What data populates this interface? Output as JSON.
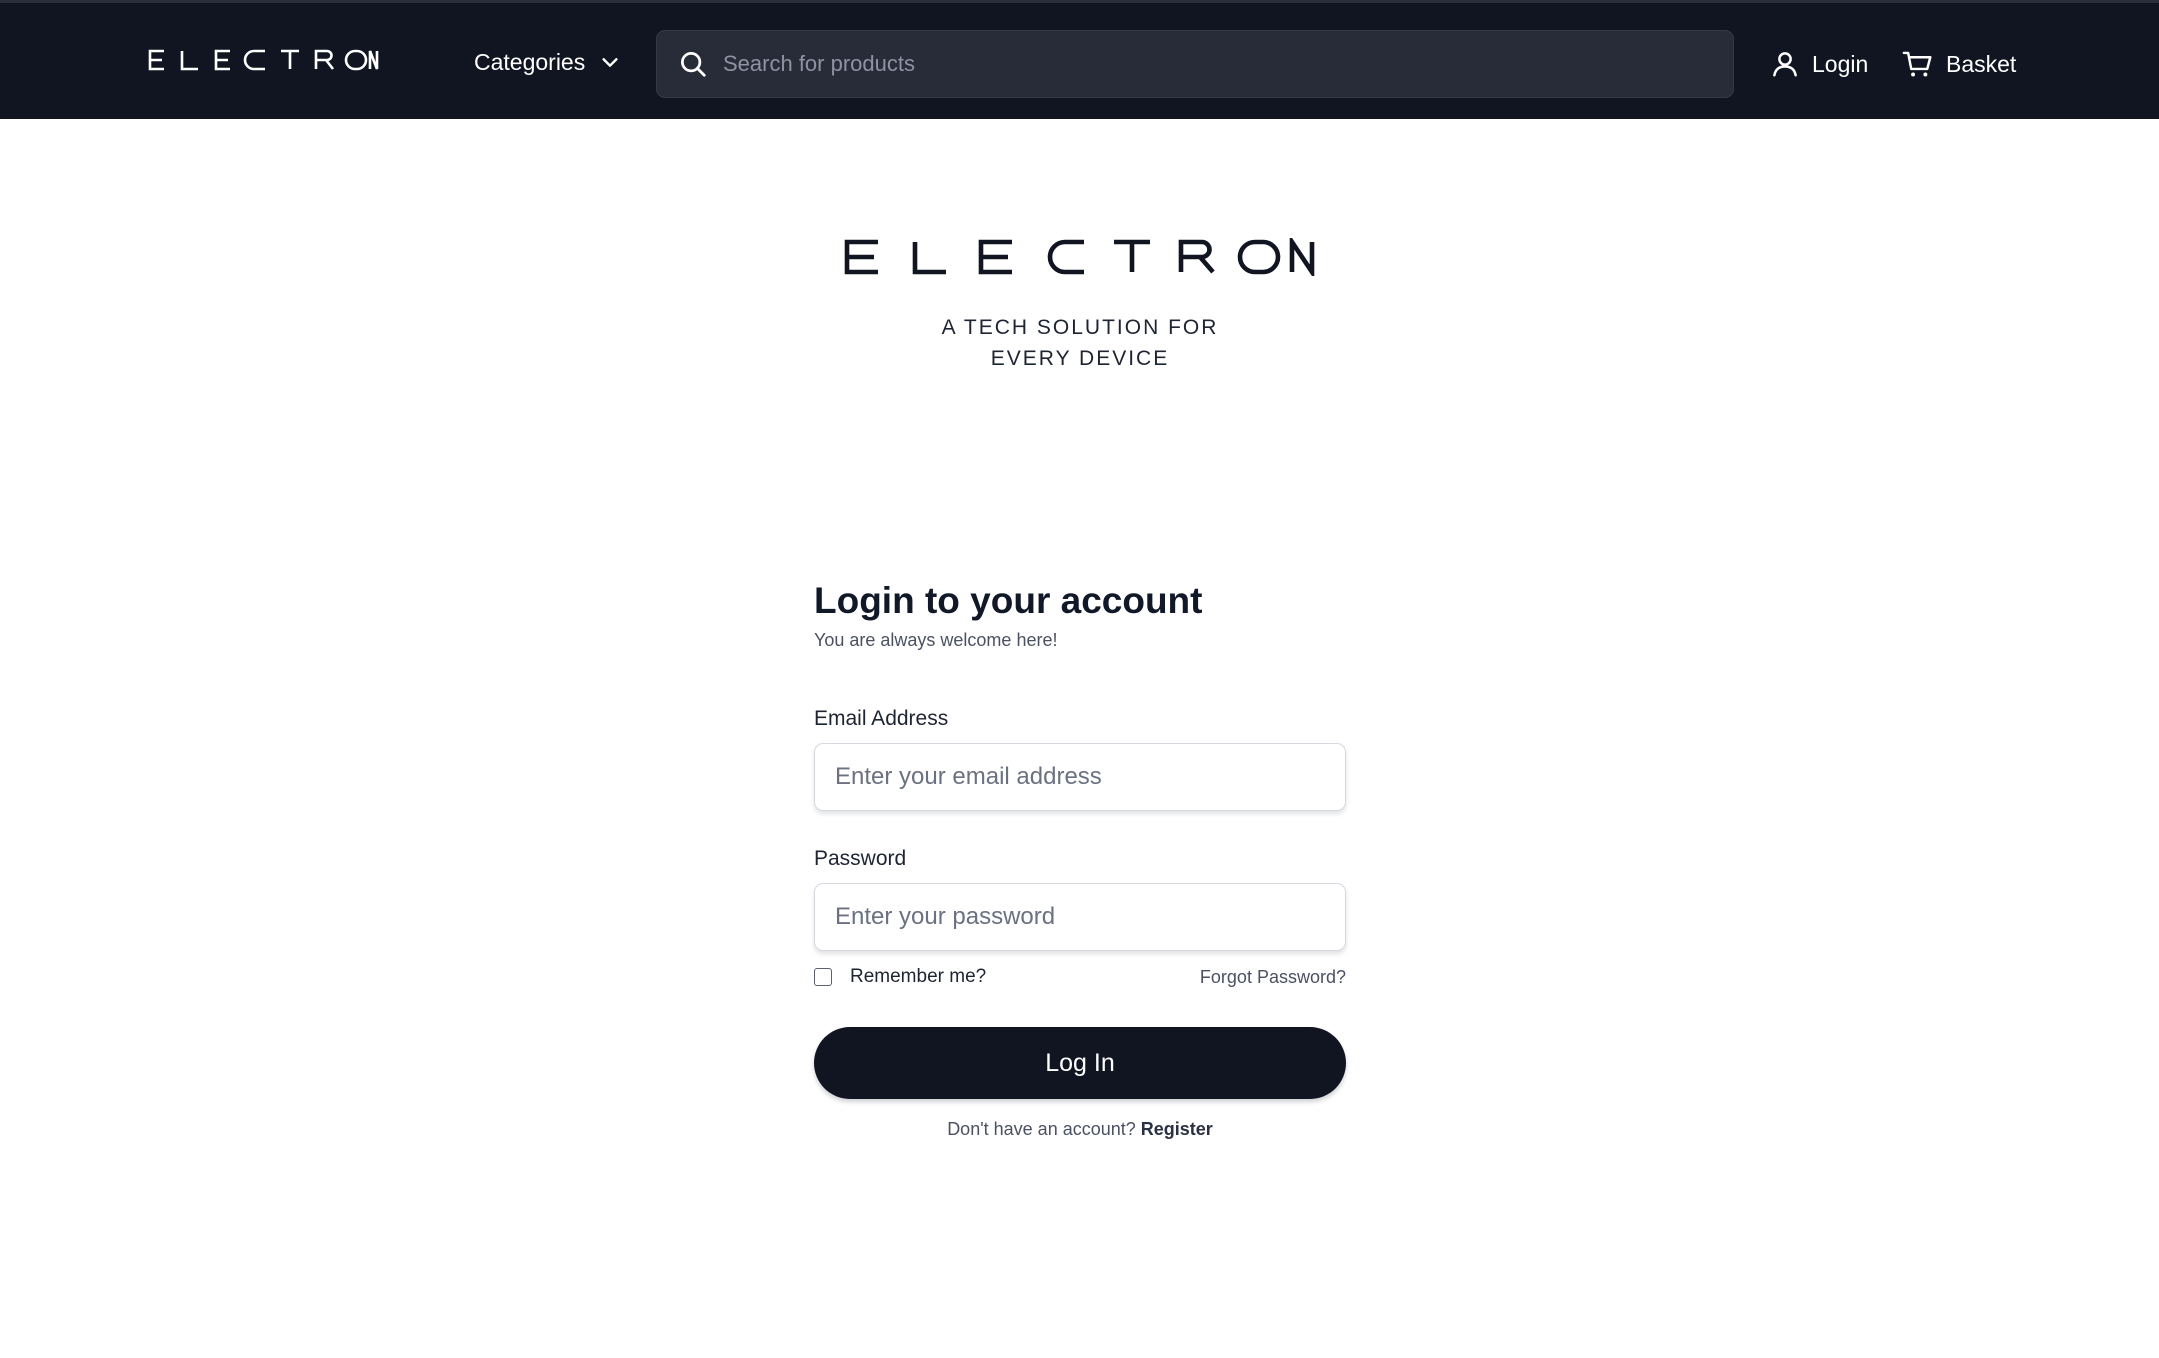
{
  "header": {
    "brand": "ELECTRON",
    "categories_label": "Categories",
    "search_placeholder": "Search for products",
    "login_label": "Login",
    "basket_label": "Basket",
    "background_color": "#111522"
  },
  "hero": {
    "brand": "ELECTRON",
    "tagline_line1": "A TECH SOLUTION FOR",
    "tagline_line2": "EVERY DEVICE"
  },
  "login_form": {
    "title": "Login to your account",
    "subtitle": "You are always welcome here!",
    "email_label": "Email Address",
    "email_placeholder": "Enter your email address",
    "password_label": "Password",
    "password_placeholder": "Enter your password",
    "remember_label": "Remember me?",
    "remember_checked": false,
    "forgot_label": "Forgot Password?",
    "submit_label": "Log In",
    "register_prompt": "Don't have an account?",
    "register_label": "Register",
    "button_color": "#111522"
  },
  "icons": {
    "categories": "chevron-down-icon",
    "search": "search-icon",
    "login": "user-icon",
    "basket": "shopping-cart-icon"
  }
}
